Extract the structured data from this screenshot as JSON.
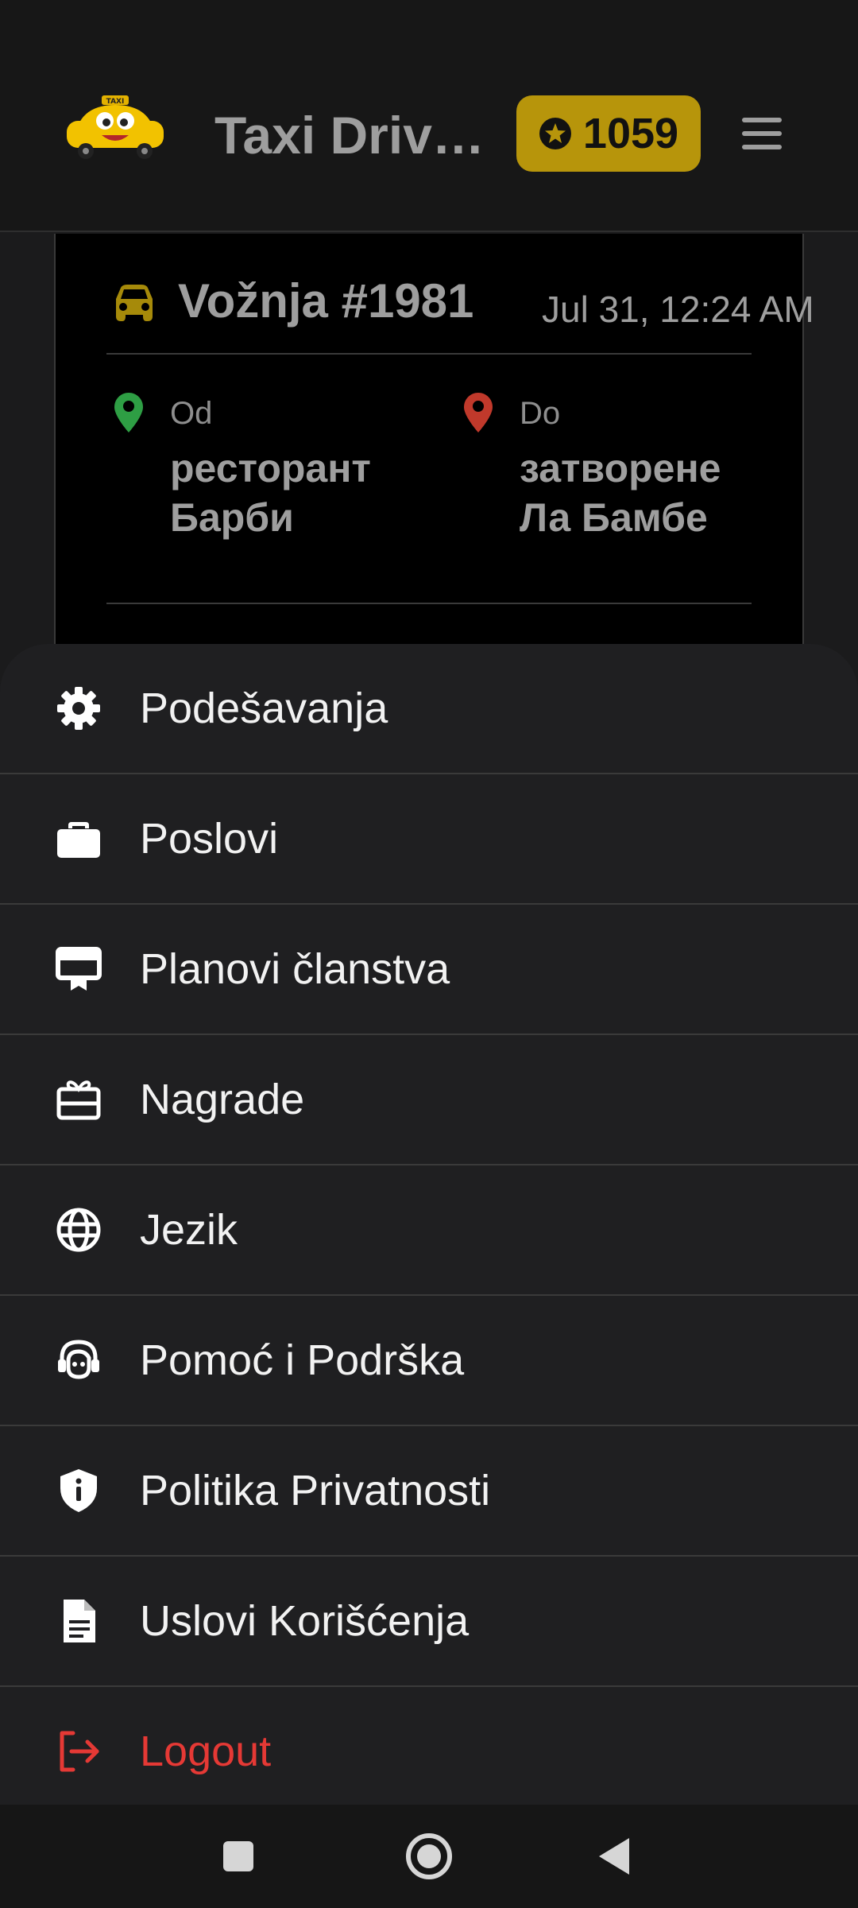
{
  "header": {
    "app_title": "Taxi Driver Loyalty",
    "points": "1059",
    "colors": {
      "badge": "#b7950b",
      "title": "#9e9e9e"
    }
  },
  "ride": {
    "title": "Vožnja #1981",
    "datetime": "Jul 31, 12:24 AM",
    "from": {
      "label": "Od",
      "name": "ресторант Барби",
      "pin_color": "#2e9e44"
    },
    "to": {
      "label": "Do",
      "name": "затворене Ла Бамбе",
      "pin_color": "#c0392b"
    }
  },
  "menu": {
    "items": [
      {
        "label": "Podešavanja",
        "icon": "gear-icon"
      },
      {
        "label": "Poslovi",
        "icon": "briefcase-icon"
      },
      {
        "label": "Planovi članstva",
        "icon": "membership-card-icon"
      },
      {
        "label": "Nagrade",
        "icon": "gift-icon"
      },
      {
        "label": "Jezik",
        "icon": "globe-icon"
      },
      {
        "label": "Pomoć i Podrška",
        "icon": "headset-icon"
      },
      {
        "label": "Politika Privatnosti",
        "icon": "shield-icon"
      },
      {
        "label": "Uslovi Korišćenja",
        "icon": "document-icon"
      },
      {
        "label": "Logout",
        "icon": "logout-icon",
        "color": "#e53935"
      }
    ]
  }
}
